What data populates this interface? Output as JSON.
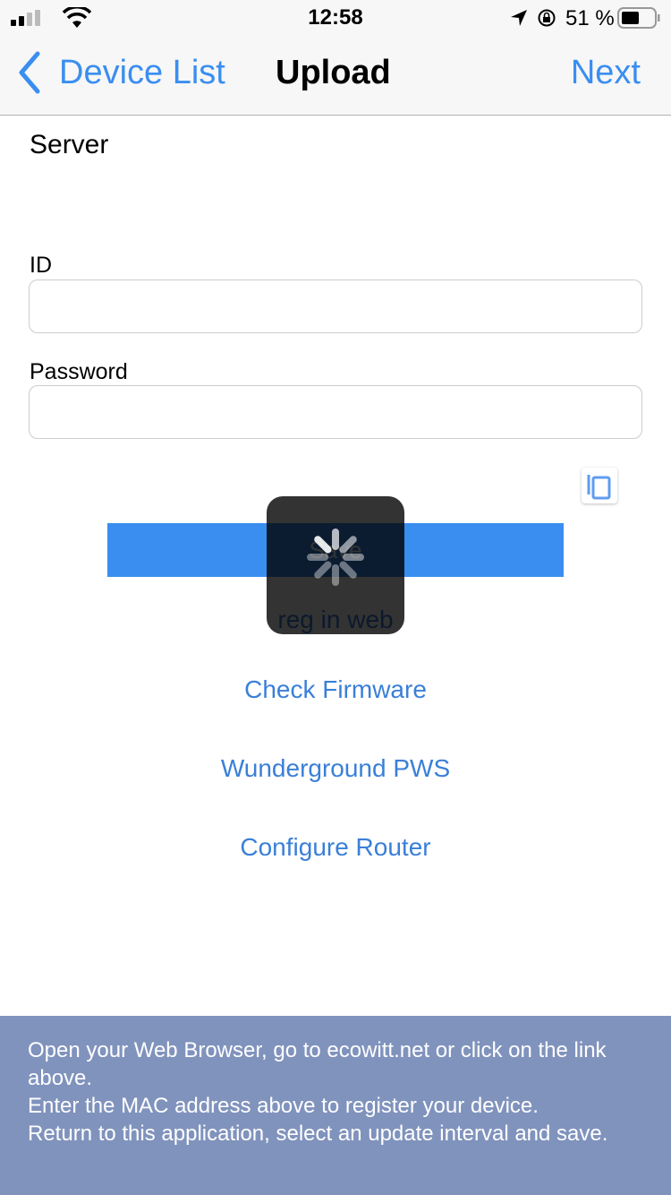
{
  "status": {
    "time": "12:58",
    "battery": "51 %",
    "icons": [
      "signal-icon",
      "wifi-icon",
      "location-icon",
      "rotation-lock-icon",
      "battery-icon"
    ]
  },
  "nav": {
    "back": "Device List",
    "title": "Upload",
    "next": "Next"
  },
  "form": {
    "section": "Server",
    "id_label": "ID",
    "id_value": "",
    "password_label": "Password",
    "password_value": ""
  },
  "save_label": "Save",
  "reg_link": "reg in web",
  "links": [
    "Check Firmware",
    "Wunderground PWS",
    "Configure Router"
  ],
  "footer": [
    "Open your Web Browser, go to ecowitt.net or click on the link above.",
    "Enter the MAC address above to register your device.",
    "Return to this application, select an update interval and save."
  ],
  "colors": {
    "accent": "#3a8ef0",
    "footer": "#8093bd"
  }
}
